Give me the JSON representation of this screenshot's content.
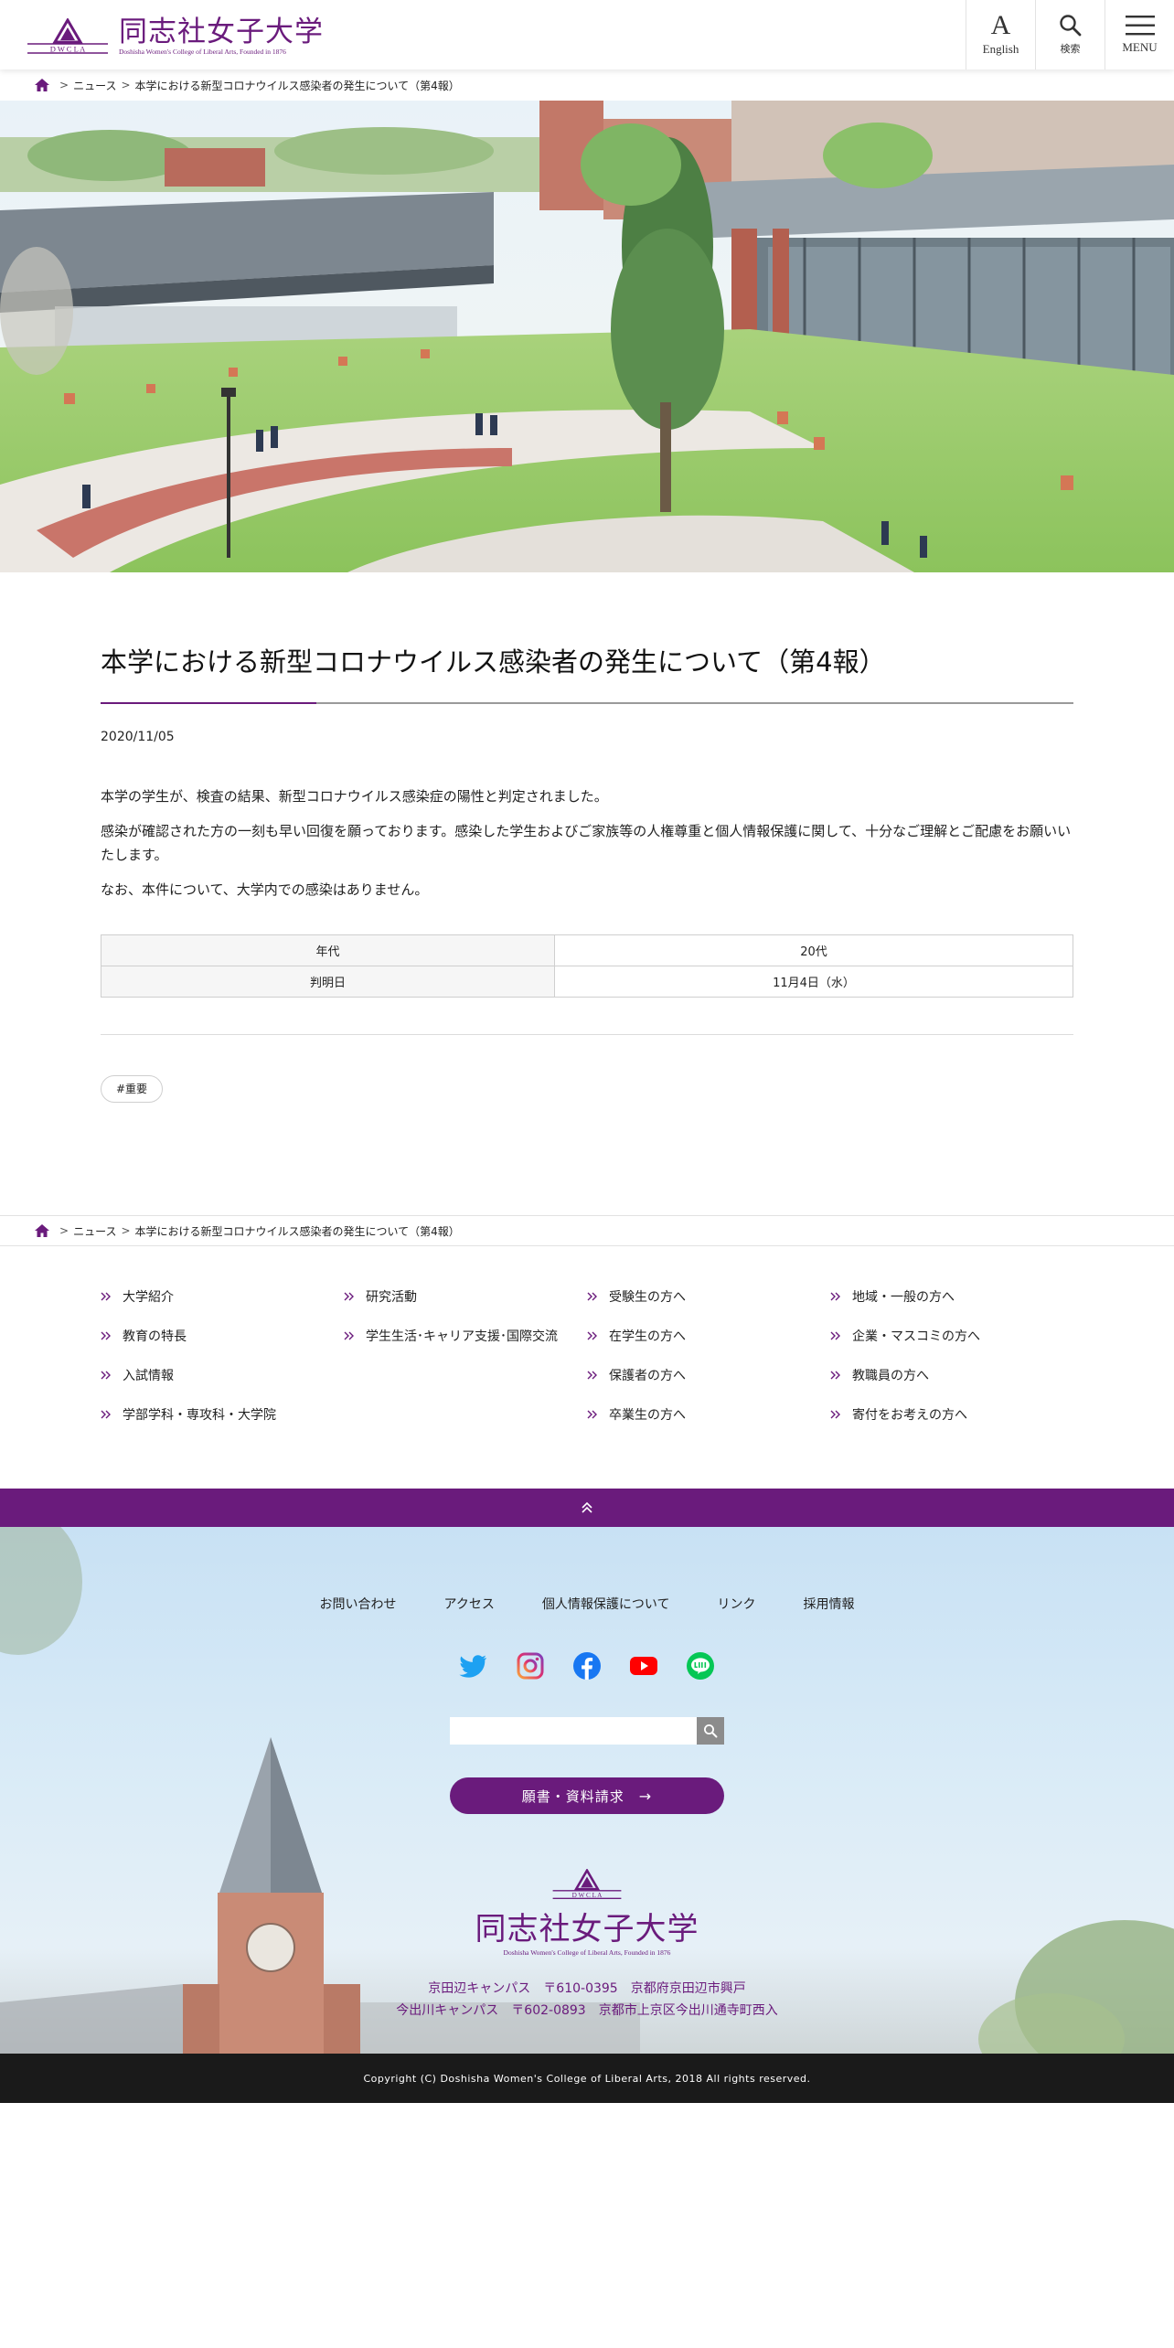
{
  "header": {
    "logo_jp": "同志社女子大学",
    "logo_en": "Doshisha Women's College of Liberal Arts, Founded in 1876",
    "logo_mark_text": "D W C L A",
    "english_label": "English",
    "english_glyph": "A",
    "search_label": "検索",
    "menu_label": "MENU"
  },
  "breadcrumb": {
    "items": [
      "ニュース",
      "本学における新型コロナウイルス感染者の発生について（第4報）"
    ],
    "separator": ">"
  },
  "article": {
    "title": "本学における新型コロナウイルス感染者の発生について（第4報）",
    "date": "2020/11/05",
    "paragraphs": [
      "本学の学生が、検査の結果、新型コロナウイルス感染症の陽性と判定されました。",
      "感染が確認された方の一刻も早い回復を願っております。感染した学生およびご家族等の人権尊重と個人情報保護に関して、十分なご理解とご配慮をお願いいたします。",
      "なお、本件について、大学内での感染はありません。"
    ],
    "table": [
      {
        "label": "年代",
        "value": "20代"
      },
      {
        "label": "判明日",
        "value": "11月4日（水）"
      }
    ],
    "tag": "#重要"
  },
  "sitemap": [
    {
      "col": 1,
      "label": "大学紹介"
    },
    {
      "col": 2,
      "label": "研究活動"
    },
    {
      "col": 3,
      "label": "受験生の方へ"
    },
    {
      "col": 4,
      "label": "地域・一般の方へ"
    },
    {
      "col": 1,
      "label": "教育の特長"
    },
    {
      "col": 2,
      "label": "学生生活･キャリア支援･国際交流"
    },
    {
      "col": 3,
      "label": "在学生の方へ"
    },
    {
      "col": 4,
      "label": "企業・マスコミの方へ"
    },
    {
      "col": 1,
      "label": "入試情報"
    },
    {
      "col": 2,
      "label": ""
    },
    {
      "col": 3,
      "label": "保護者の方へ"
    },
    {
      "col": 4,
      "label": "教職員の方へ"
    },
    {
      "col": 1,
      "label": "学部学科・専攻科・大学院"
    },
    {
      "col": 2,
      "label": ""
    },
    {
      "col": 3,
      "label": "卒業生の方へ"
    },
    {
      "col": 4,
      "label": "寄付をお考えの方へ"
    }
  ],
  "footer": {
    "nav": [
      "お問い合わせ",
      "アクセス",
      "個人情報保護について",
      "リンク",
      "採用情報"
    ],
    "social": [
      "twitter-icon",
      "instagram-icon",
      "facebook-icon",
      "youtube-icon",
      "line-icon"
    ],
    "search_placeholder": "",
    "request_label": "願書・資料請求",
    "request_arrow": "→",
    "logo_jp": "同志社女子大学",
    "logo_en": "Doshisha Women's College of Liberal Arts, Founded in 1876",
    "address_1": "京田辺キャンパス　〒610-0395　京都府京田辺市興戸",
    "address_2": "今出川キャンパス　〒602-0893　京都市上京区今出川通寺町西入",
    "copyright": "Copyright (C) Doshisha Women's College of Liberal Arts, 2018 All rights reserved."
  },
  "colors": {
    "brand_purple": "#6a1b7c",
    "footer_dark": "#1a1a1a"
  }
}
